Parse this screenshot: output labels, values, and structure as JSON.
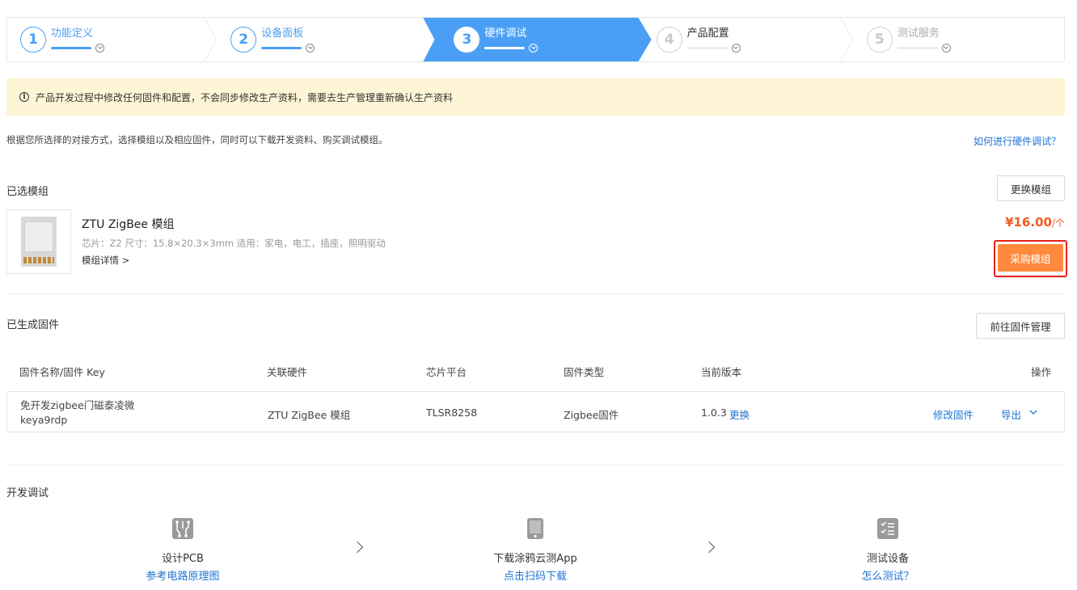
{
  "steps": [
    {
      "num": "1",
      "label": "功能定义",
      "state": "done"
    },
    {
      "num": "2",
      "label": "设备面板",
      "state": "done"
    },
    {
      "num": "3",
      "label": "硬件调试",
      "state": "active"
    },
    {
      "num": "4",
      "label": "产品配置",
      "state": "todo"
    },
    {
      "num": "5",
      "label": "测试服务",
      "state": "todo"
    }
  ],
  "notice": {
    "icon": "info-icon",
    "text": "产品开发过程中修改任何固件和配置，不会同步修改生产资料，需要去生产管理重新确认生产资料"
  },
  "description": "根据您所选择的对接方式，选择模组以及相应固件，同时可以下载开发资料、购买调试模组。",
  "help_link": "如何进行硬件调试？",
  "selected_module": {
    "title": "已选模组",
    "change_button": "更换模组",
    "name": "ZTU ZigBee 模组",
    "spec": "芯片：Z2   尺寸：15.8×20.3×3mm   适用：家电，电工，插座，照明驱动",
    "details_link": "模组详情 >",
    "price": "¥16.00",
    "unit": "/个",
    "buy_button": "采购模组"
  },
  "firmware": {
    "title": "已生成固件",
    "manage_button": "前往固件管理",
    "columns": [
      "固件名称/固件 Key",
      "关联硬件",
      "芯片平台",
      "固件类型",
      "当前版本",
      "操作"
    ],
    "rows": [
      {
        "name": "免开发zigbee门磁泰凌微",
        "key": "keya9rdp",
        "hardware": "ZTU ZigBee 模组",
        "chip": "TLSR8258",
        "type": "Zigbee固件",
        "version": "1.0.3",
        "replace": "更换",
        "edit": "修改固件",
        "export": "导出"
      }
    ]
  },
  "dev_debug": {
    "title": "开发调试",
    "items": [
      {
        "icon": "pcb-icon",
        "label": "设计PCB",
        "link": "参考电路原理图"
      },
      {
        "icon": "phone-icon",
        "label": "下载涂鸦云测App",
        "link": "点击扫码下载"
      },
      {
        "icon": "checklist-icon",
        "label": "测试设备",
        "link": "怎么测试？"
      }
    ]
  },
  "colors": {
    "accent": "#4a9ff5",
    "link": "#1e73d2",
    "price": "#f05a1e",
    "buy": "#ff8a3d",
    "notice_bg": "#fef5d6",
    "highlight": "#e8201c"
  }
}
